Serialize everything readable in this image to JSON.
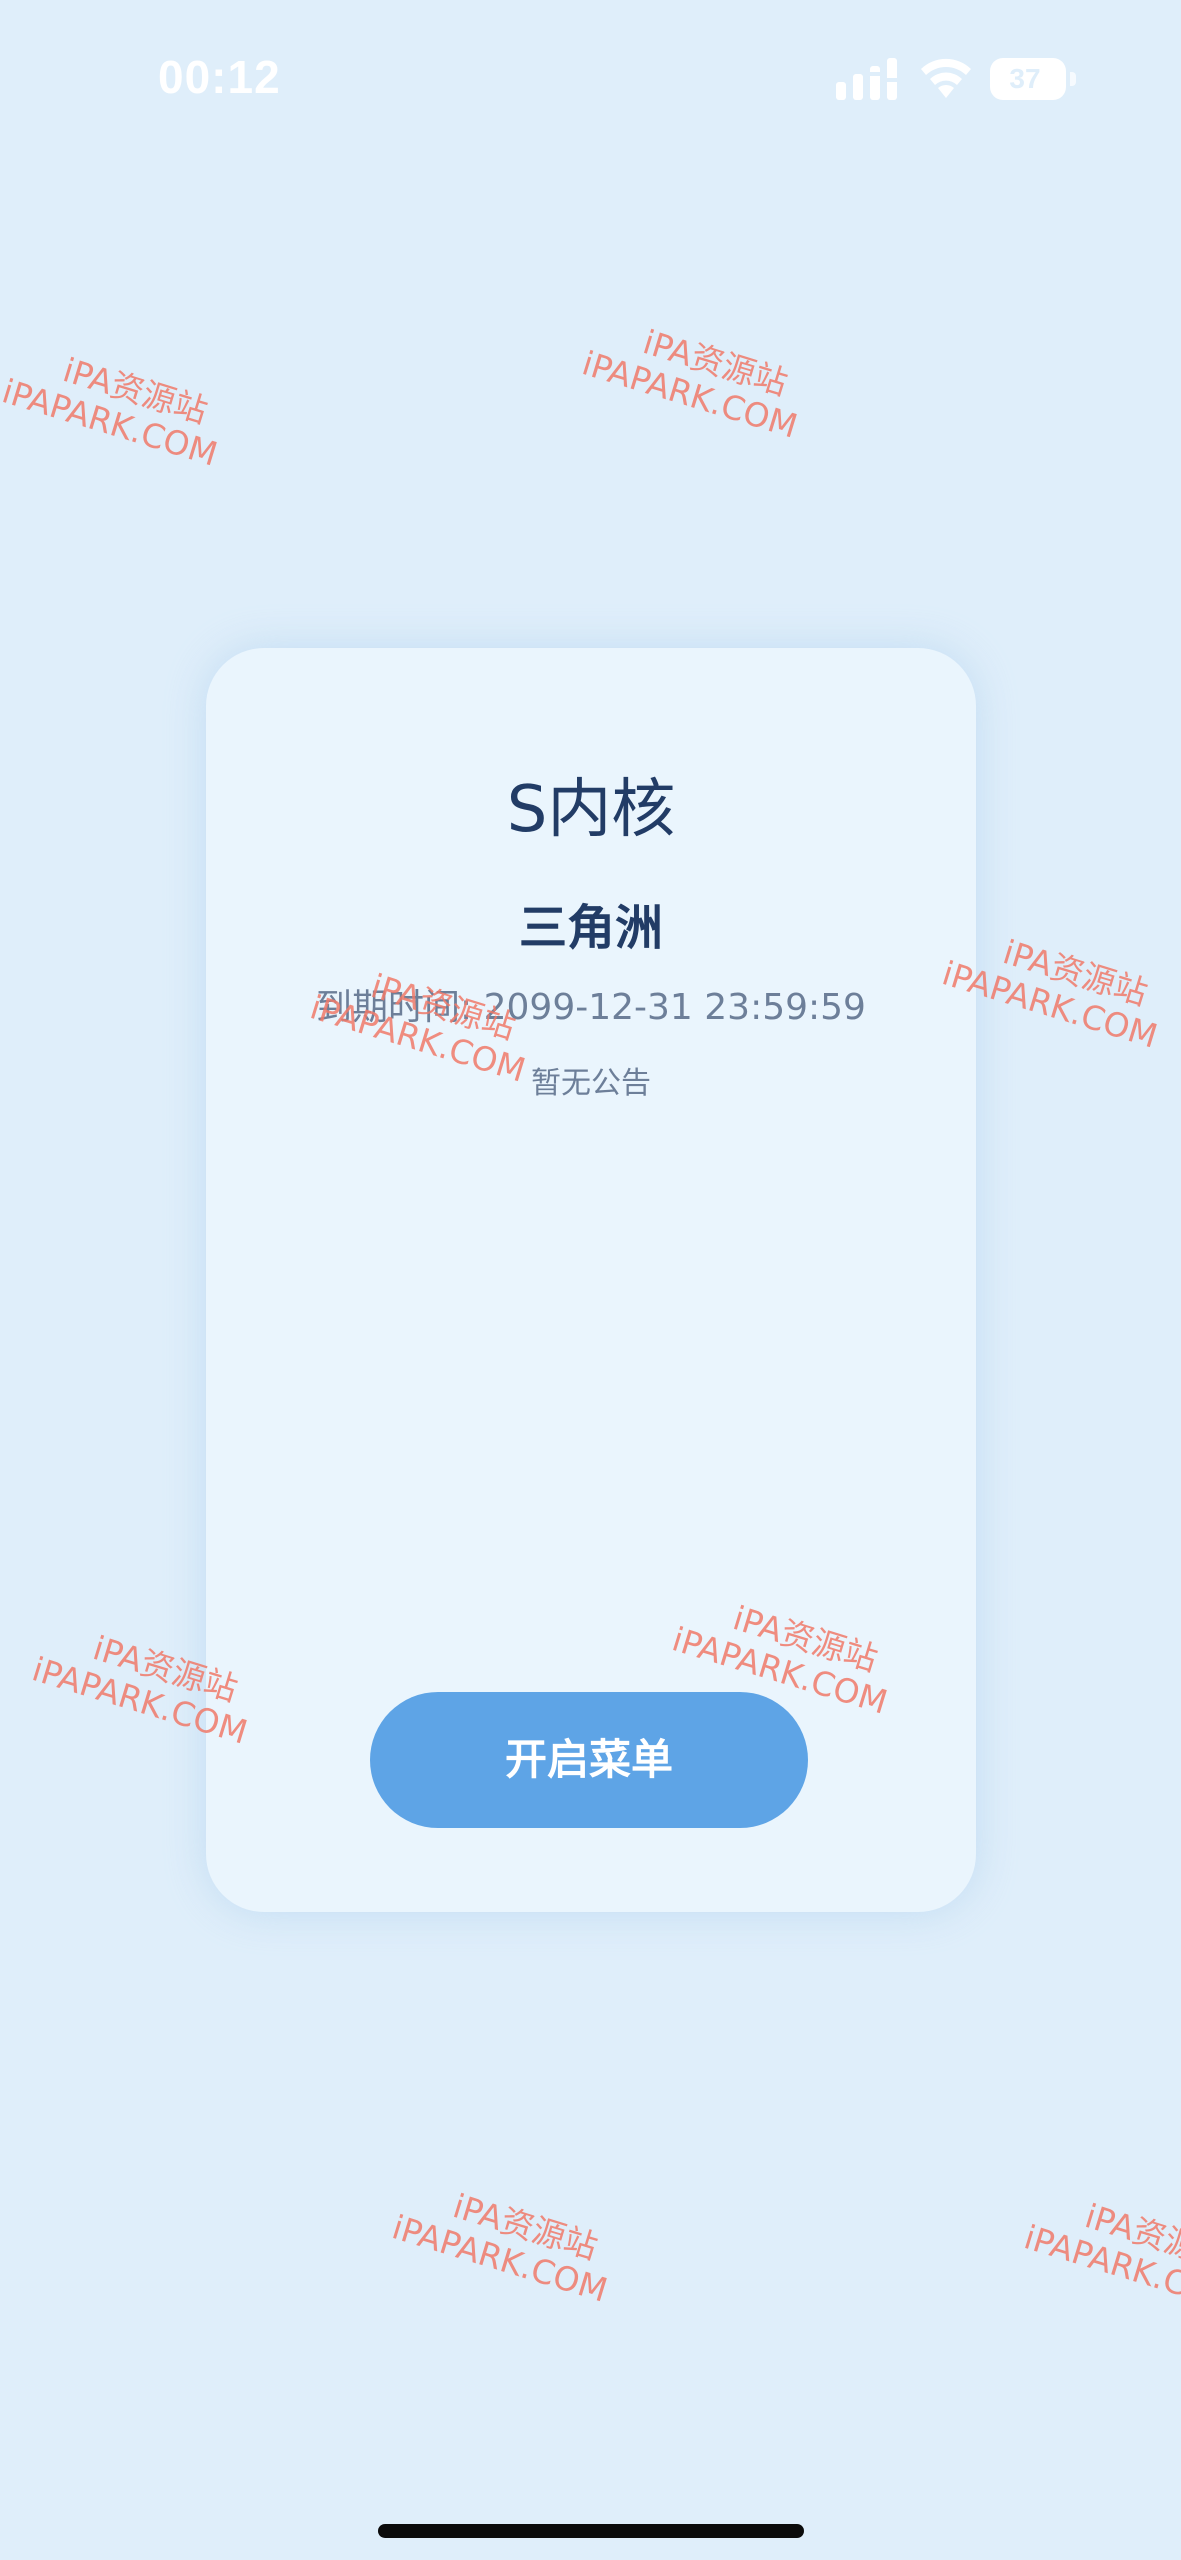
{
  "status_bar": {
    "time": "00:12",
    "battery_level": "37",
    "icons": [
      "signal-icon",
      "wifi-icon",
      "battery-icon"
    ]
  },
  "card": {
    "title": "S内核",
    "subtitle": "三角洲",
    "expiry": "到期时间: 2099-12-31 23:59:59",
    "notice": "暂无公告",
    "button_label": "开启菜单"
  },
  "watermark": {
    "line1": "iPA资源站",
    "line2": "iPAPARK.COM"
  },
  "colors": {
    "background": "#dfeefa",
    "card": "#eaf5fd",
    "accent": "#5ea4e6",
    "title_text": "#223c66",
    "secondary_text": "#6d7f99",
    "watermark": "#f07a6a"
  }
}
